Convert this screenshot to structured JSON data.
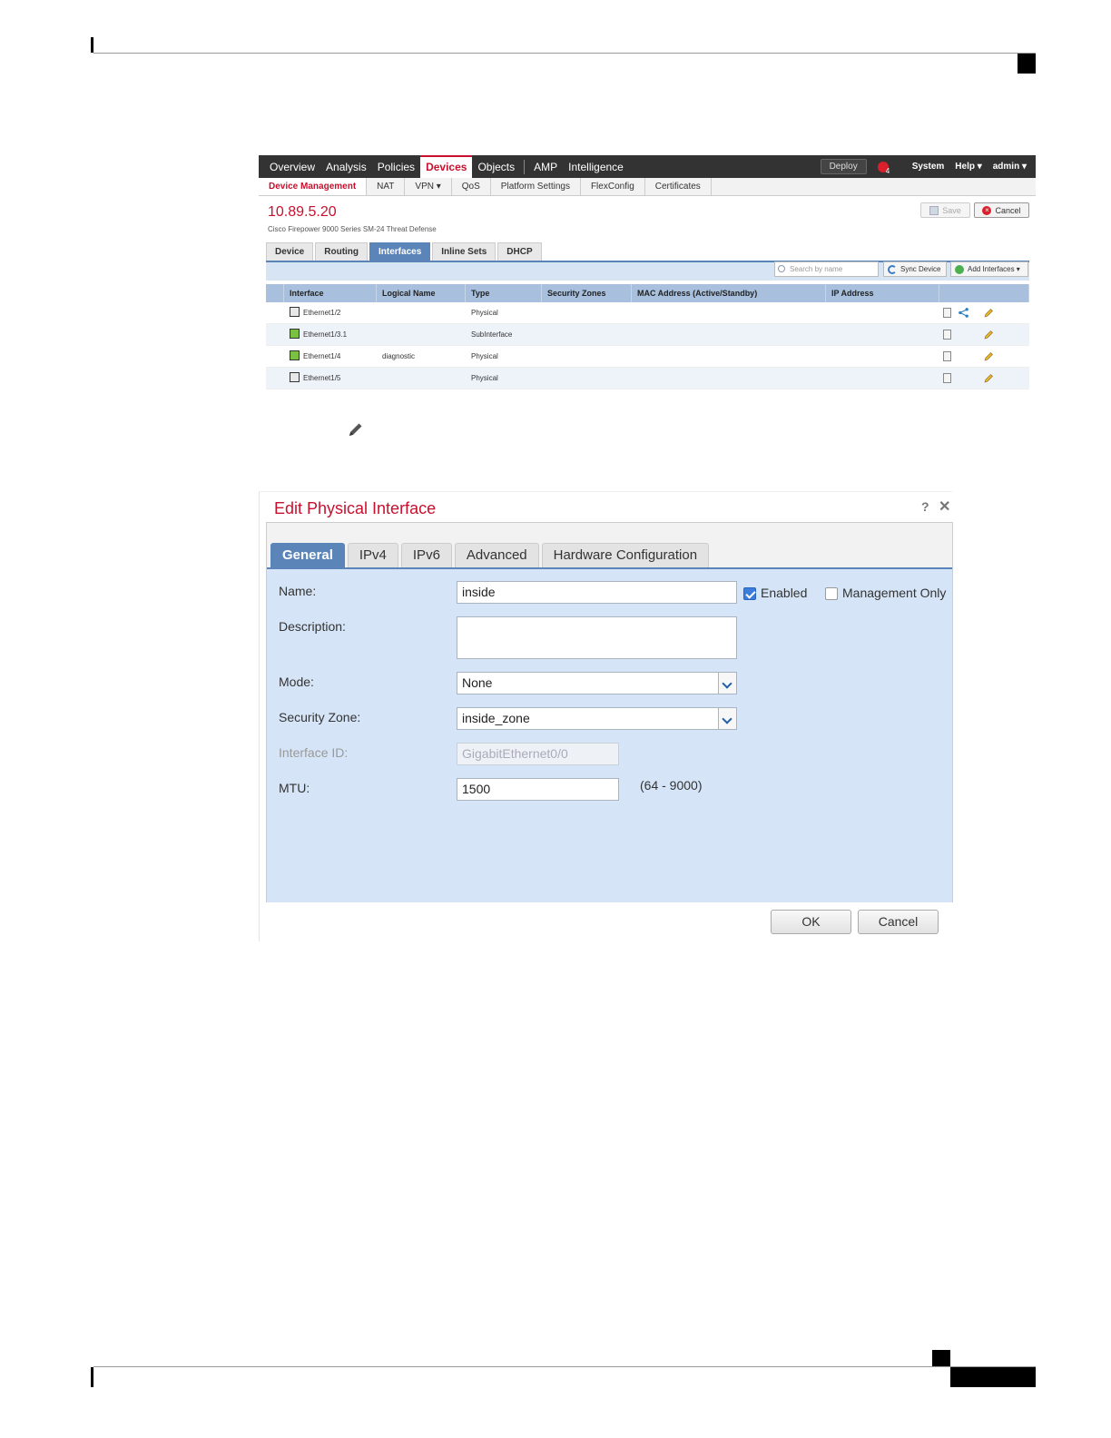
{
  "fmc": {
    "topnav": [
      "Overview",
      "Analysis",
      "Policies",
      "Devices",
      "Objects",
      "AMP",
      "Intelligence"
    ],
    "deploy": "Deploy",
    "alert_count": "4",
    "system": "System",
    "help": "Help ▾",
    "admin": "admin ▾",
    "subnav": [
      "Device Management",
      "NAT",
      "VPN ▾",
      "QoS",
      "Platform Settings",
      "FlexConfig",
      "Certificates"
    ],
    "device_title": "10.89.5.20",
    "device_subtitle": "Cisco Firepower 9000 Series SM-24 Threat Defense",
    "save": "Save",
    "cancel": "Cancel",
    "tabs": [
      "Device",
      "Routing",
      "Interfaces",
      "Inline Sets",
      "DHCP"
    ],
    "search_placeholder": "Search by name",
    "sync_device": "Sync Device",
    "add_interfaces": "Add Interfaces ▾",
    "columns": [
      "Interface",
      "Logical Name",
      "Type",
      "Security Zones",
      "MAC Address (Active/Standby)",
      "IP Address"
    ],
    "rows": [
      {
        "interface": "Ethernet1/2",
        "logical_name": "",
        "type": "Physical"
      },
      {
        "interface": "Ethernet1/3.1",
        "logical_name": "",
        "type": "SubInterface"
      },
      {
        "interface": "Ethernet1/4",
        "logical_name": "diagnostic",
        "type": "Physical"
      },
      {
        "interface": "Ethernet1/5",
        "logical_name": "",
        "type": "Physical"
      }
    ]
  },
  "dialog": {
    "title": "Edit Physical Interface",
    "help": "?",
    "close": "✕",
    "tabs": [
      "General",
      "IPv4",
      "IPv6",
      "Advanced",
      "Hardware Configuration"
    ],
    "name_label": "Name:",
    "name_value": "inside",
    "enabled_label": "Enabled",
    "management_only_label": "Management Only",
    "description_label": "Description:",
    "description_value": "",
    "mode_label": "Mode:",
    "mode_value": "None",
    "zone_label": "Security Zone:",
    "zone_value": "inside_zone",
    "interface_id_label": "Interface ID:",
    "interface_id_value": "GigabitEthernet0/0",
    "mtu_label": "MTU:",
    "mtu_value": "1500",
    "mtu_range": "(64 - 9000)",
    "ok": "OK",
    "cancel": "Cancel"
  },
  "colors": {
    "accent": "#c8102e",
    "tab_blue": "#5b84b8",
    "panel": "#d5e5f7"
  }
}
